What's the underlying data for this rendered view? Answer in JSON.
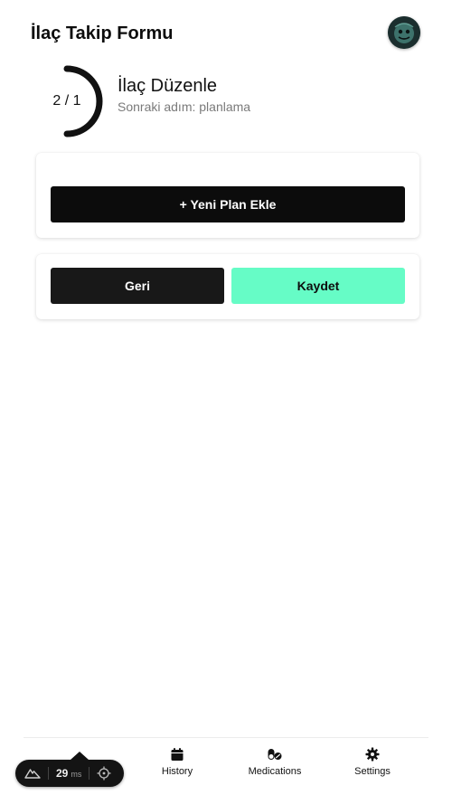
{
  "header": {
    "title": "İlaç Takip Formu"
  },
  "step": {
    "count": "2 / 1",
    "title": "İlaç Düzenle",
    "subtitle": "Sonraki adım: planlama"
  },
  "plan_card": {
    "add_button": "+ Yeni Plan Ekle"
  },
  "actions": {
    "back": "Geri",
    "save": "Kaydet"
  },
  "nav": {
    "items": [
      {
        "label": "History",
        "icon": "calendar-icon"
      },
      {
        "label": "Medications",
        "icon": "pills-icon"
      },
      {
        "label": "Settings",
        "icon": "gear-icon"
      }
    ]
  },
  "dev_toolbar": {
    "render_time": "29",
    "unit": "ms"
  },
  "colors": {
    "primary_dark": "#0c0c0c",
    "accent_green": "#66fcc6",
    "muted_text": "#7a7a7a"
  }
}
